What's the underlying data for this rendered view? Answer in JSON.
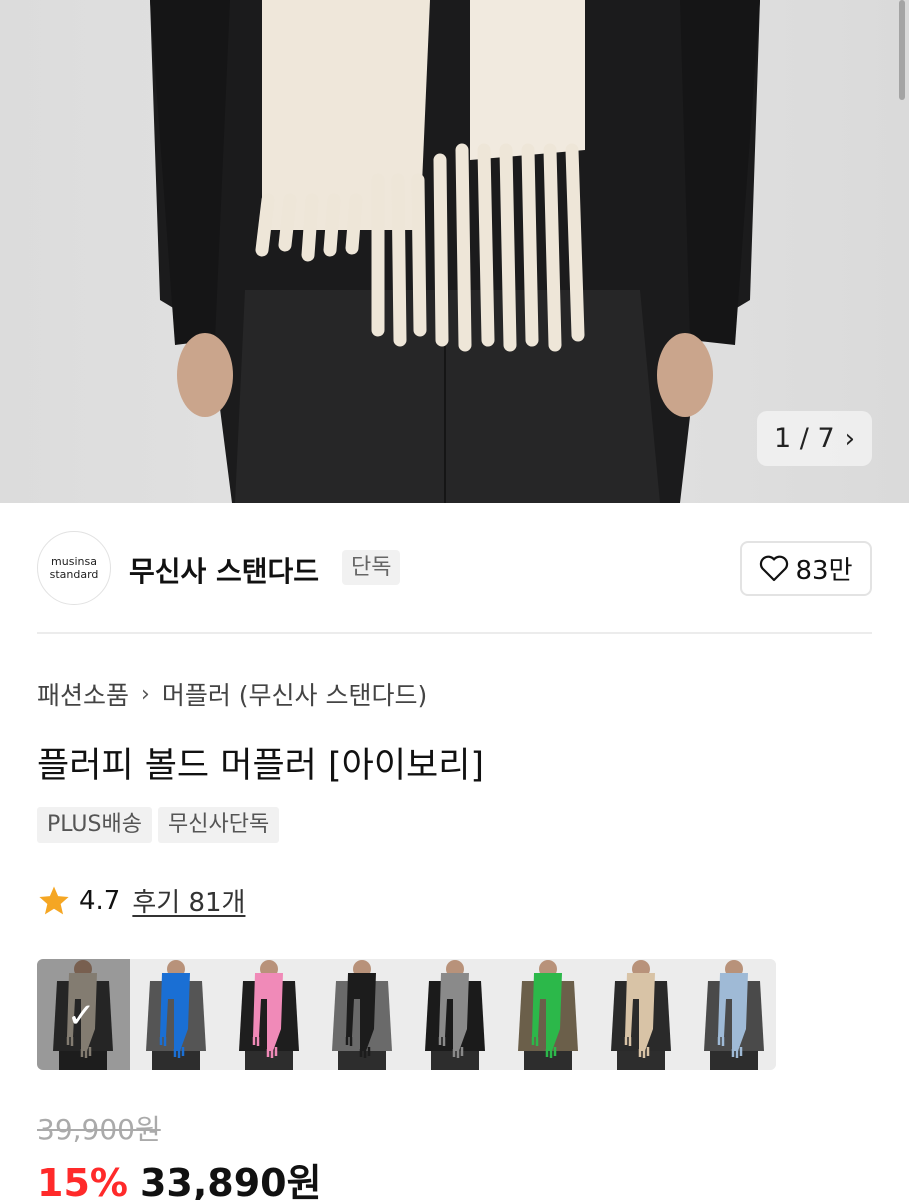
{
  "hero": {
    "pager_current": "1",
    "pager_sep": "/",
    "pager_total": "7",
    "next_icon": "chevron-right-icon"
  },
  "brand": {
    "logo_line1": "musinsa",
    "logo_line2": "standard",
    "name": "무신사 스탠다드",
    "badge": "단독",
    "like_icon": "heart-outline-icon",
    "like_count": "83만"
  },
  "breadcrumb": {
    "category": "패션소품",
    "separator": "›",
    "subcategory": "머플러 (무신사 스탠다드)"
  },
  "product": {
    "title": "플러피 볼드 머플러 [아이보리]",
    "tags": [
      "PLUS배송",
      "무신사단독"
    ],
    "rating": "4.7",
    "review_label": "후기 81개",
    "star_color": "#f5a623"
  },
  "swatches": [
    {
      "color": "#c9bfae",
      "selected": true
    },
    {
      "color": "#1a6fd4",
      "selected": false
    },
    {
      "color": "#f08ab8",
      "selected": false
    },
    {
      "color": "#1c1c1c",
      "selected": false
    },
    {
      "color": "#8a8a8a",
      "selected": false
    },
    {
      "color": "#2cb84a",
      "selected": false
    },
    {
      "color": "#d8c3a6",
      "selected": false
    },
    {
      "color": "#9fbad6",
      "selected": false
    }
  ],
  "price": {
    "original": "39,900원",
    "discount": "15%",
    "final": "33,890원",
    "discount_color": "#ff2a2a"
  }
}
